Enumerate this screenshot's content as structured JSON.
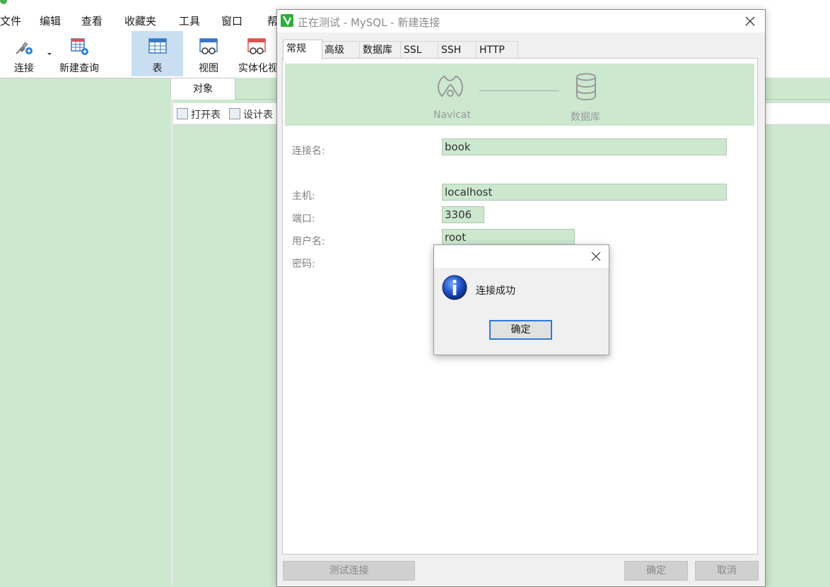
{
  "menu": {
    "items": [
      "文件",
      "编辑",
      "查看",
      "收藏夹",
      "工具",
      "窗口",
      "帮"
    ]
  },
  "toolbar": {
    "buttons": [
      {
        "label": "连接",
        "icon": "plug-icon"
      },
      {
        "label": "新建查询",
        "icon": "new-query-icon"
      },
      {
        "label": "表",
        "icon": "table-icon",
        "active": true
      },
      {
        "label": "视图",
        "icon": "view-icon"
      },
      {
        "label": "实体化视",
        "icon": "materialized-view-icon"
      }
    ]
  },
  "object_tab": {
    "label": "对象"
  },
  "object_toolbar": {
    "open_table": "打开表",
    "design_table": "设计表"
  },
  "dialog": {
    "title": "正在测试 - MySQL - 新建连接",
    "tabs": [
      "常规",
      "高级",
      "数据库",
      "SSL",
      "SSH",
      "HTTP"
    ],
    "active_tab": "常规",
    "banner": {
      "left_label": "Navicat",
      "right_label": "数据库"
    },
    "form": {
      "connection_name": {
        "label": "连接名:",
        "value": "book"
      },
      "host": {
        "label": "主机:",
        "value": "localhost"
      },
      "port": {
        "label": "端口:",
        "value": "3306"
      },
      "username": {
        "label": "用户名:",
        "value": "root"
      },
      "password": {
        "label": "密码:"
      }
    },
    "buttons": {
      "test": "测试连接",
      "ok": "确定",
      "cancel": "取消"
    }
  },
  "message_box": {
    "text": "连接成功",
    "ok_label": "确定",
    "icon": "info-icon"
  },
  "colors": {
    "eye_care_green": "#cce8cf",
    "active_tool": "#c9def1",
    "focus_border": "#2b7cd3"
  }
}
